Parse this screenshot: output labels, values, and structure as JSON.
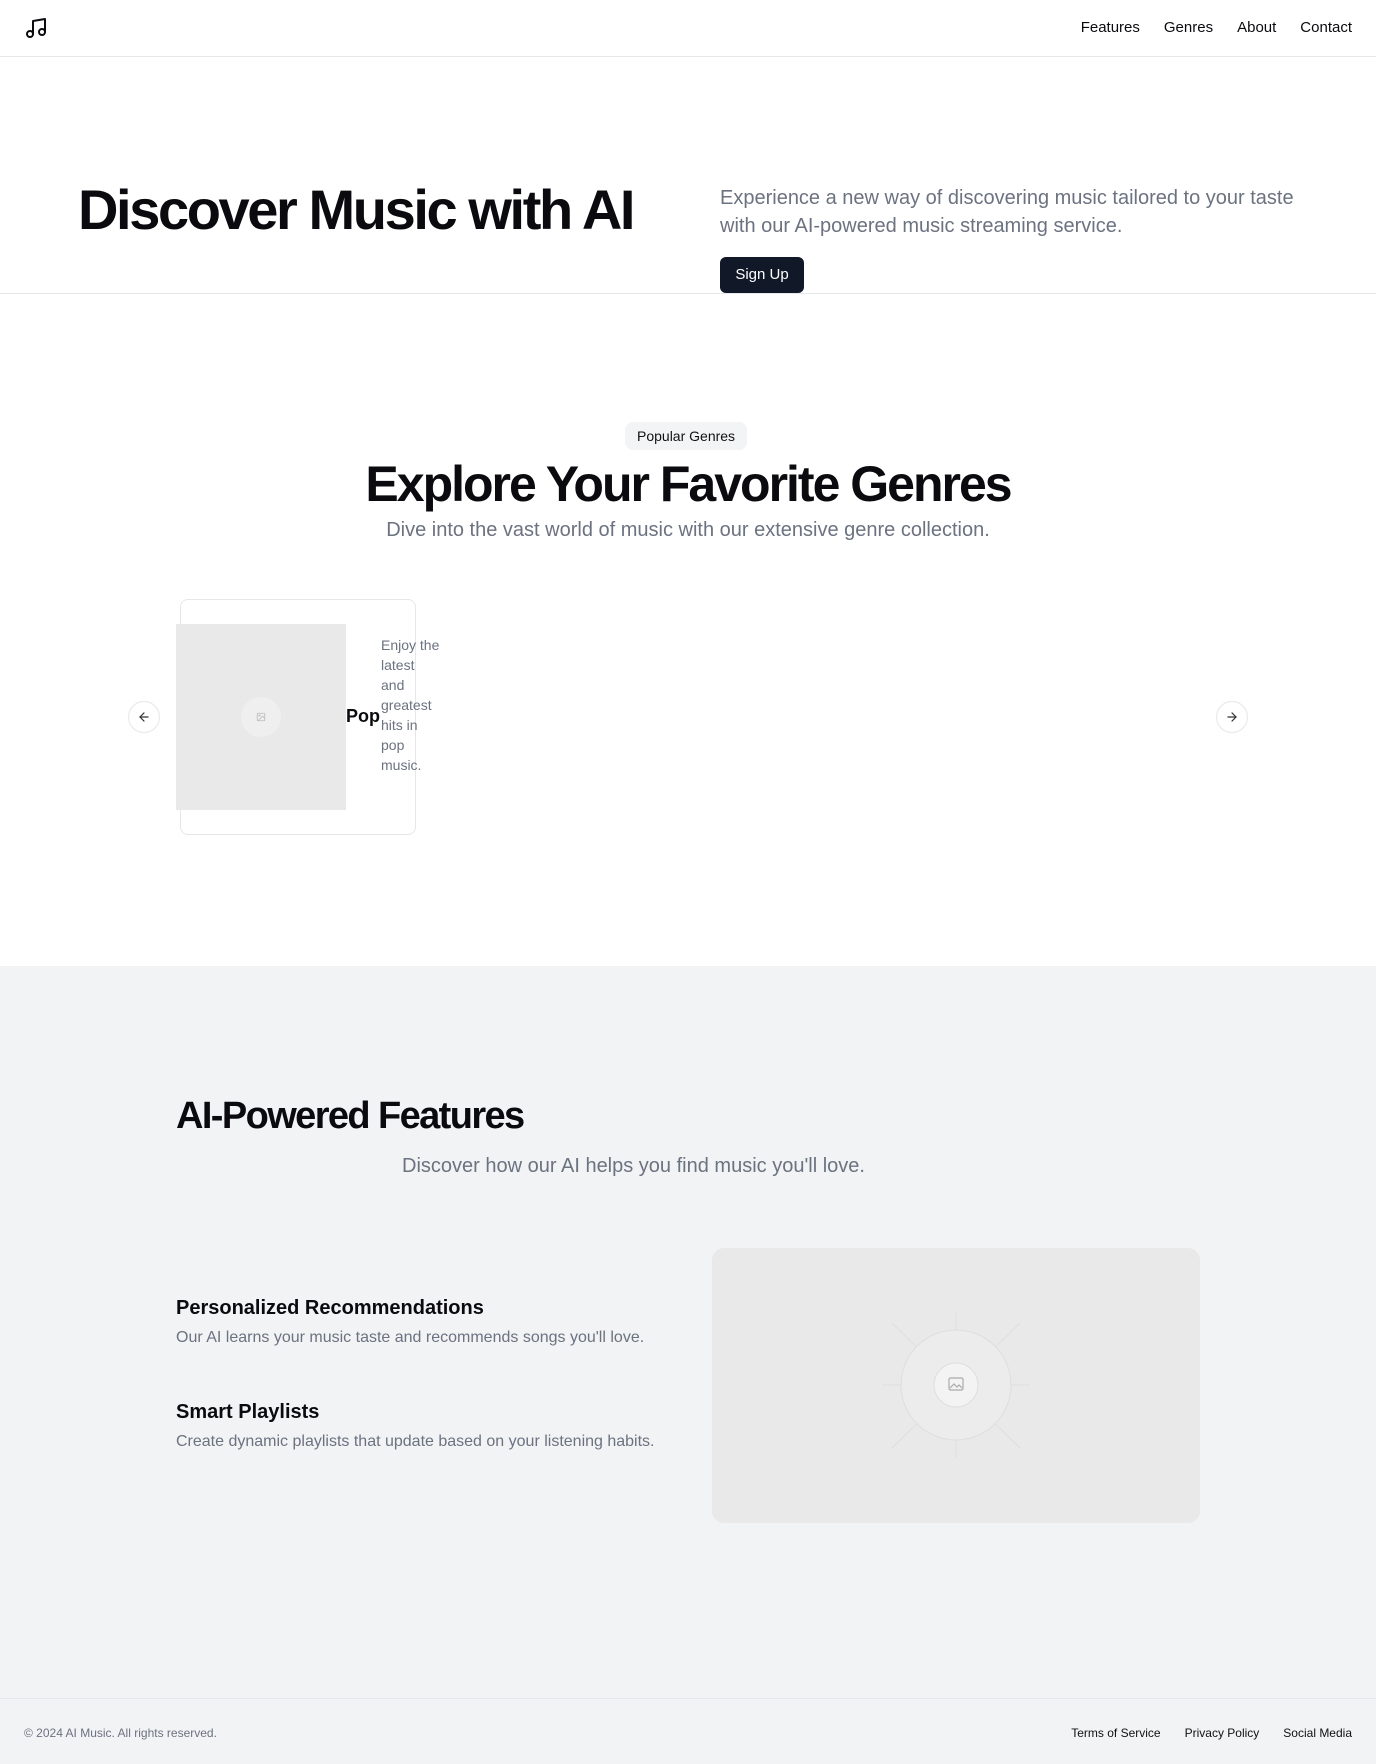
{
  "header": {
    "logo_icon": "music-note-icon",
    "nav": [
      {
        "label": "Features"
      },
      {
        "label": "Genres"
      },
      {
        "label": "About"
      },
      {
        "label": "Contact"
      }
    ]
  },
  "hero": {
    "title": "Discover Music with AI",
    "description": "Experience a new way of discovering music tailored to your taste with our AI-powered music streaming service.",
    "cta_label": "Sign Up"
  },
  "genres": {
    "badge": "Popular Genres",
    "title": "Explore Your Favorite Genres",
    "subtitle": "Dive into the vast world of music with our extensive genre collection.",
    "prev_icon": "arrow-left-icon",
    "next_icon": "arrow-right-icon",
    "cards": [
      {
        "name": "Pop",
        "description": "Enjoy the latest and greatest hits in pop music."
      }
    ]
  },
  "features": {
    "title": "AI-Powered Features",
    "subtitle": "Discover how our AI helps you find music you'll love.",
    "items": [
      {
        "title": "Personalized Recommendations",
        "description": "Our AI learns your music taste and recommends songs you'll love."
      },
      {
        "title": "Smart Playlists",
        "description": "Create dynamic playlists that update based on your listening habits."
      }
    ],
    "image_icon": "image-placeholder-icon"
  },
  "footer": {
    "copyright": "© 2024 AI Music. All rights reserved.",
    "links": [
      {
        "label": "Terms of Service"
      },
      {
        "label": "Privacy Policy"
      },
      {
        "label": "Social Media"
      }
    ]
  },
  "colors": {
    "primary_button": "#111827",
    "muted_text": "#6b7280",
    "section_bg": "#f2f3f5",
    "border": "#e5e7eb"
  }
}
